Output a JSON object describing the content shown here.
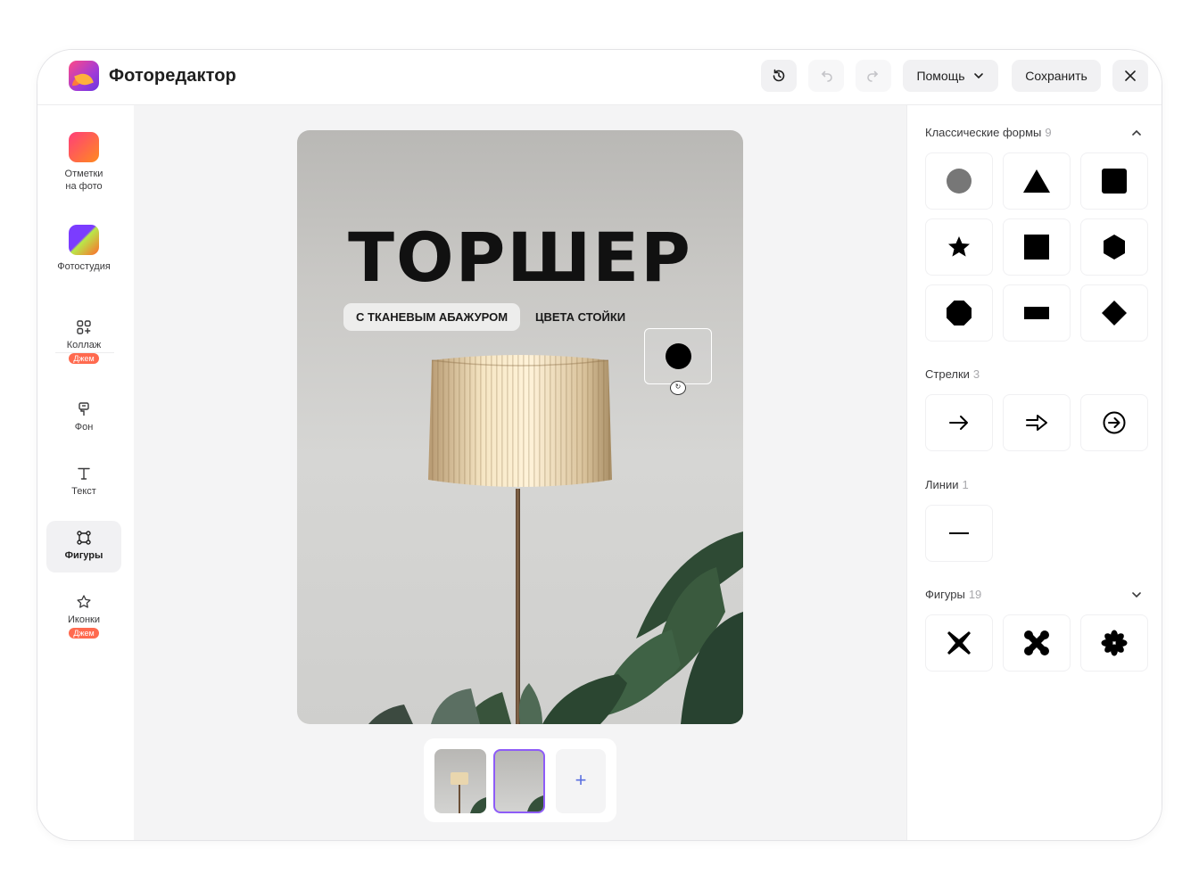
{
  "app": {
    "title": "Фоторедактор"
  },
  "header": {
    "help_label": "Помощь",
    "save_label": "Сохранить"
  },
  "sidebar": {
    "items": [
      {
        "label1": "Отметки",
        "label2": "на фото"
      },
      {
        "label1": "Фотостудия"
      },
      {
        "label1": "Коллаж",
        "badge": "Джем"
      },
      {
        "label1": "Фон"
      },
      {
        "label1": "Текст"
      },
      {
        "label1": "Фигуры",
        "active": true
      },
      {
        "label1": "Иконки",
        "badge": "Джем"
      }
    ]
  },
  "canvas": {
    "headline": "ТОРШЕР",
    "chip_selected": "С ТКАНЕВЫМ АБАЖУРОМ",
    "chip_plain": "ЦВЕТА СТОЙКИ",
    "add_label": "+"
  },
  "panel": {
    "sections": [
      {
        "title": "Классические формы",
        "count": "9"
      },
      {
        "title": "Стрелки",
        "count": "3"
      },
      {
        "title": "Линии",
        "count": "1"
      },
      {
        "title": "Фигуры",
        "count": "19"
      }
    ]
  },
  "colors": {
    "accent": "#8e5cf7",
    "badge": "#ff6a4f",
    "shape_circle": "#777777"
  }
}
